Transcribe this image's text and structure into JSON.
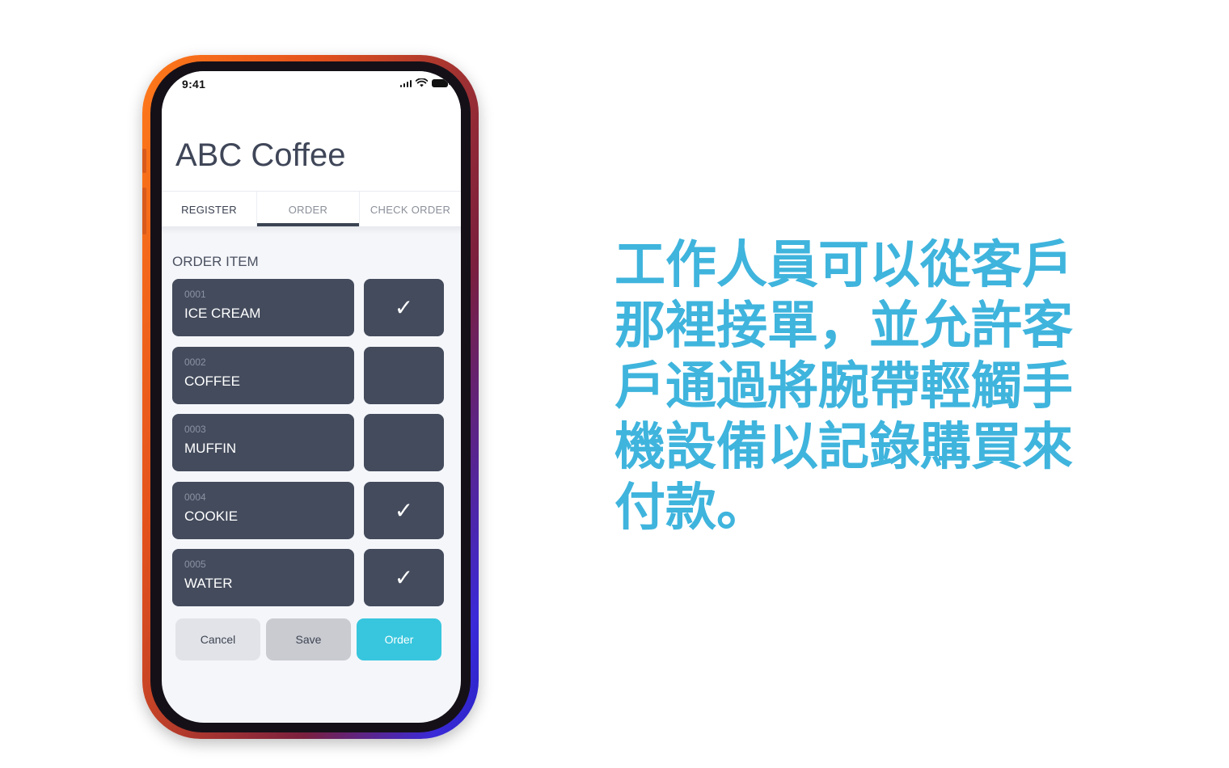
{
  "status_bar": {
    "time": "9:41"
  },
  "app": {
    "title": "ABC Coffee"
  },
  "tabs": [
    {
      "label": "REGISTER"
    },
    {
      "label": "ORDER"
    },
    {
      "label": "CHECK ORDER"
    }
  ],
  "order_section": {
    "label": "ORDER ITEM"
  },
  "items": [
    {
      "code": "0001",
      "name": "ICE CREAM",
      "check": "✓"
    },
    {
      "code": "0002",
      "name": "COFFEE",
      "check": ""
    },
    {
      "code": "0003",
      "name": "MUFFIN",
      "check": ""
    },
    {
      "code": "0004",
      "name": "COOKIE",
      "check": "✓"
    },
    {
      "code": "0005",
      "name": "WATER",
      "check": "✓"
    }
  ],
  "buttons": {
    "cancel": "Cancel",
    "save": "Save",
    "order": "Order"
  },
  "caption": {
    "text": "工作人員可以從客戶那裡接單，並允許客戶通過將腕帶輕觸手機設備以記錄購買來付款。"
  },
  "colors": {
    "accent": "#37c6de",
    "caption": "#3fb4dd",
    "card": "#434b5c"
  }
}
